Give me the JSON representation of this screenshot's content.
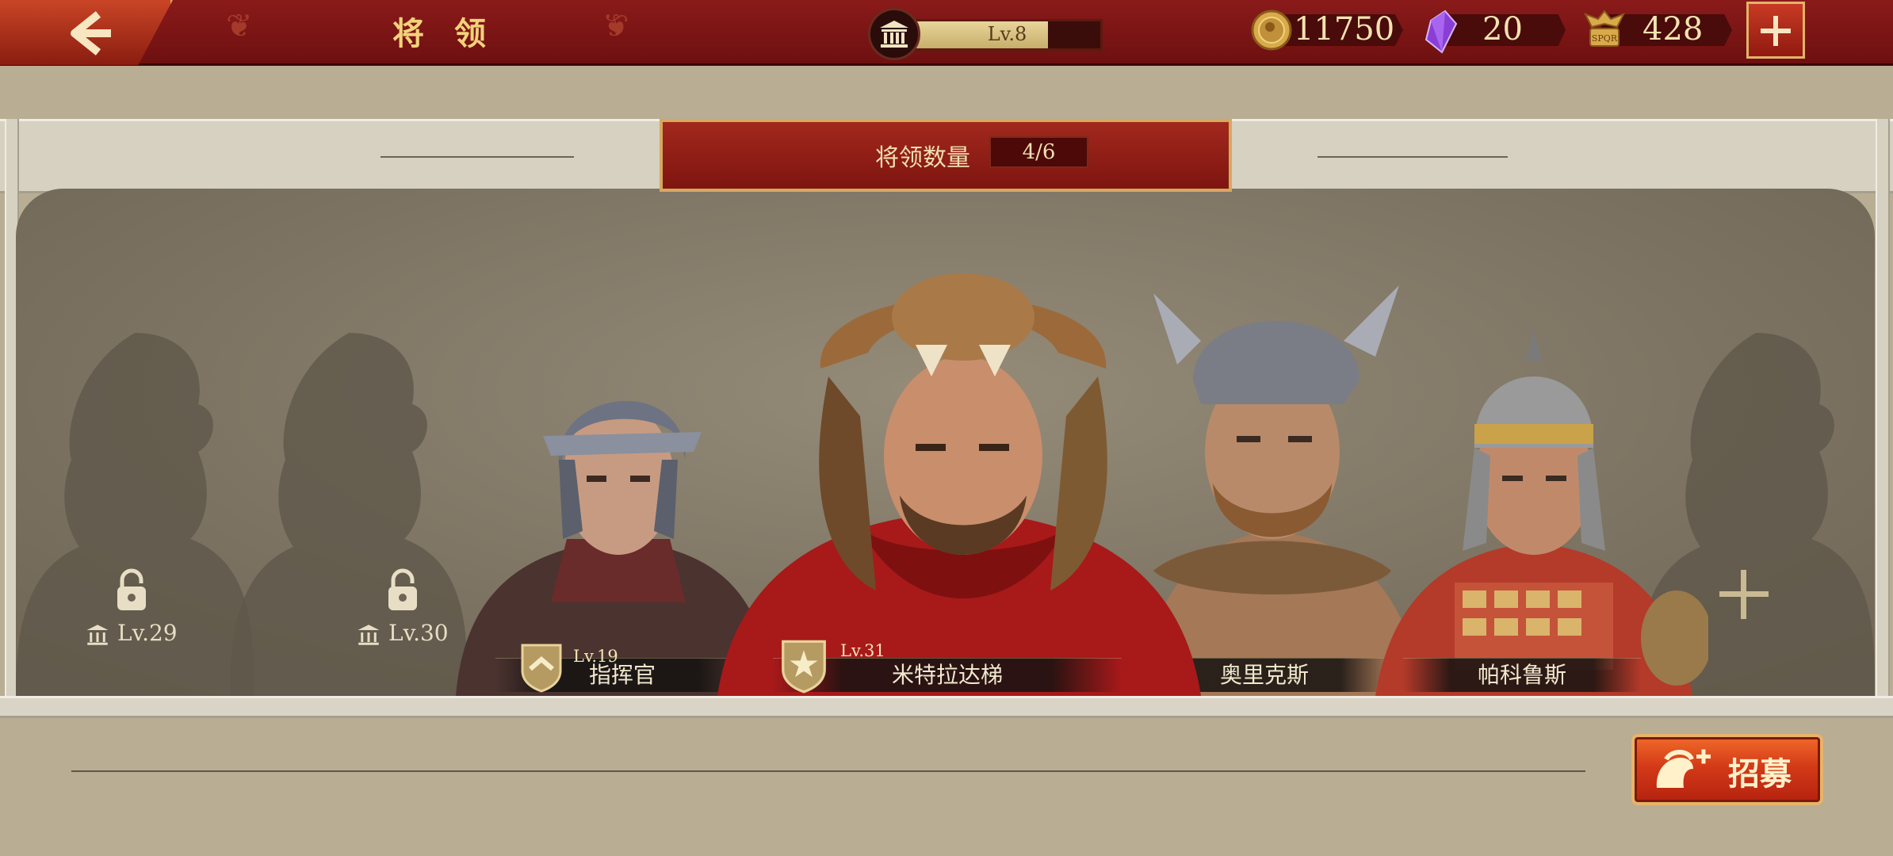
{
  "header": {
    "title": "将 领",
    "player_level": "Lv.8",
    "level_progress": 0.72
  },
  "resources": [
    {
      "icon": "gold-coin-icon",
      "value": "11750"
    },
    {
      "icon": "purple-gem-icon",
      "value": "20"
    },
    {
      "icon": "spqr-eagle-icon",
      "value": "428"
    }
  ],
  "general_count": {
    "label": "将领数量",
    "value": "4/6"
  },
  "locked_slots": [
    {
      "level": "Lv.29"
    },
    {
      "level": "Lv.30"
    }
  ],
  "heroes": [
    {
      "name": "指挥官",
      "level": "Lv.19",
      "rank": "chevron",
      "helmet": "#6d7382",
      "armor": "#5b3d3a"
    },
    {
      "name": "米特拉达梯",
      "level": "Lv.31",
      "rank": "star",
      "helmet": "#9c6a3a",
      "armor": "#b9211b"
    },
    {
      "name": "奥里克斯",
      "level": "",
      "rank": "",
      "helmet": "#7a7d85",
      "armor": "#7b5a3a"
    },
    {
      "name": "帕科鲁斯",
      "level": "",
      "rank": "",
      "helmet": "#9a9a9a",
      "armor": "#b43a2a"
    }
  ],
  "recruit": {
    "label": "招募"
  },
  "colors": {
    "topbar": "#7a1414",
    "gold_text": "#f2d27a",
    "stage": "#857b69",
    "recruit": "#d43a18"
  }
}
